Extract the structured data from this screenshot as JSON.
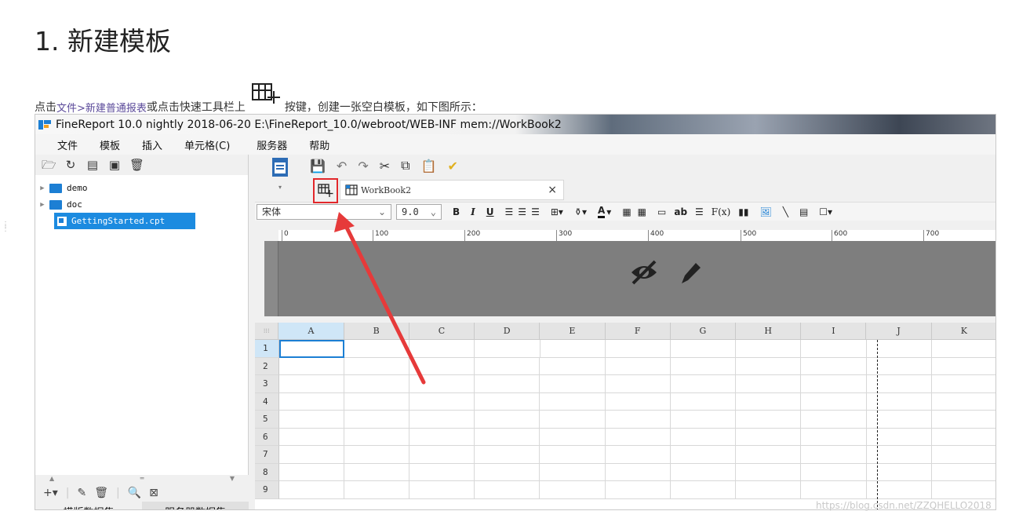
{
  "doc": {
    "heading": "1. 新建模板",
    "intro_prefix": "点击 ",
    "intro_link": "文件>新建普通报表",
    "intro_mid": " 或点击快速工具栏上 ",
    "intro_suffix": " 按键，创建一张空白模板，如下图所示：",
    "watermark": "https://blog.csdn.net/ZZQHELLO2018"
  },
  "window": {
    "title": "FineReport 10.0 nightly 2018-06-20 E:\\FineReport_10.0/webroot/WEB-INF    mem://WorkBook2"
  },
  "menu": {
    "items": [
      "文件",
      "模板",
      "插入",
      "单元格(C)",
      "服务器",
      "帮助"
    ]
  },
  "tree": {
    "items": [
      {
        "label": "demo",
        "type": "folder"
      },
      {
        "label": "doc",
        "type": "folder"
      },
      {
        "label": "GettingStarted.cpt",
        "type": "file",
        "selected": true
      }
    ]
  },
  "dataset_tabs": [
    "模版数据集",
    "服务器数据集"
  ],
  "tab": {
    "workbook_label": "WorkBook2",
    "close": "×"
  },
  "format": {
    "font": "宋体",
    "size": "9.0",
    "bold": "B",
    "italic": "I",
    "underline": "U",
    "text_ab": "ab",
    "fx": "F(x)"
  },
  "ruler": {
    "ticks": [
      "0",
      "100",
      "200",
      "300",
      "400",
      "500",
      "600",
      "700"
    ]
  },
  "grid": {
    "columns": [
      "A",
      "B",
      "C",
      "D",
      "E",
      "F",
      "G",
      "H",
      "I",
      "J",
      "K"
    ],
    "rows": [
      "1",
      "2",
      "3",
      "4",
      "5",
      "6",
      "7",
      "8",
      "9"
    ]
  },
  "colors": {
    "accent_blue": "#1c7fd4",
    "highlight_red": "#e2272b",
    "link_purple": "#5b4a9a"
  }
}
